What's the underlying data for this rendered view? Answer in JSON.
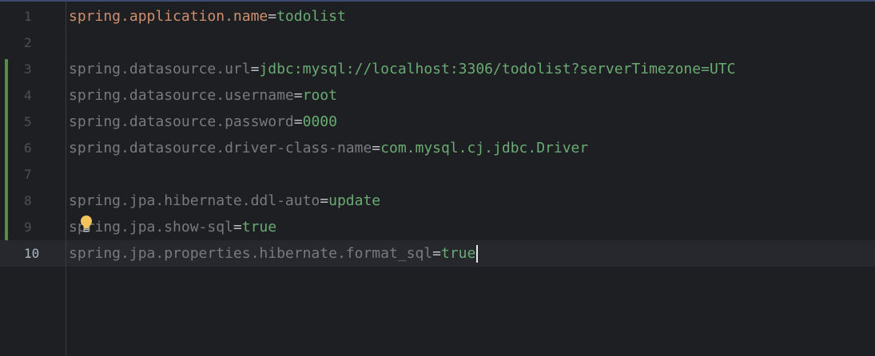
{
  "editor": {
    "lines": [
      {
        "num": "1",
        "key": "spring.application.name",
        "eq": "=",
        "value": "todolist"
      },
      {
        "num": "2",
        "key": "",
        "eq": "",
        "value": ""
      },
      {
        "num": "3",
        "key": "spring.datasource.url",
        "eq": "=",
        "value": "jdbc:mysql://localhost:3306/todolist?serverTimezone=UTC"
      },
      {
        "num": "4",
        "key": "spring.datasource.username",
        "eq": "=",
        "value": "root"
      },
      {
        "num": "5",
        "key": "spring.datasource.password",
        "eq": "=",
        "value": "0000"
      },
      {
        "num": "6",
        "key": "spring.datasource.driver-class-name",
        "eq": "=",
        "value": "com.mysql.cj.jdbc.Driver"
      },
      {
        "num": "7",
        "key": "",
        "eq": "",
        "value": ""
      },
      {
        "num": "8",
        "key": "spring.jpa.hibernate.ddl-auto",
        "eq": "=",
        "value": "update"
      },
      {
        "num": "9",
        "key": "spring.jpa.show-sql",
        "eq": "=",
        "value": "true"
      },
      {
        "num": "10",
        "key": "spring.jpa.properties.hibernate.format_sql",
        "eq": "=",
        "value": "true"
      }
    ],
    "current_line": "10",
    "intention_icon": "lightbulb-icon",
    "colors": {
      "background": "#1e1f22",
      "key": "#787a80",
      "value": "#6aab73",
      "first_key": "#cf8e6d",
      "change_marker": "#5b8a4e",
      "bulb": "#f2c55c"
    }
  }
}
